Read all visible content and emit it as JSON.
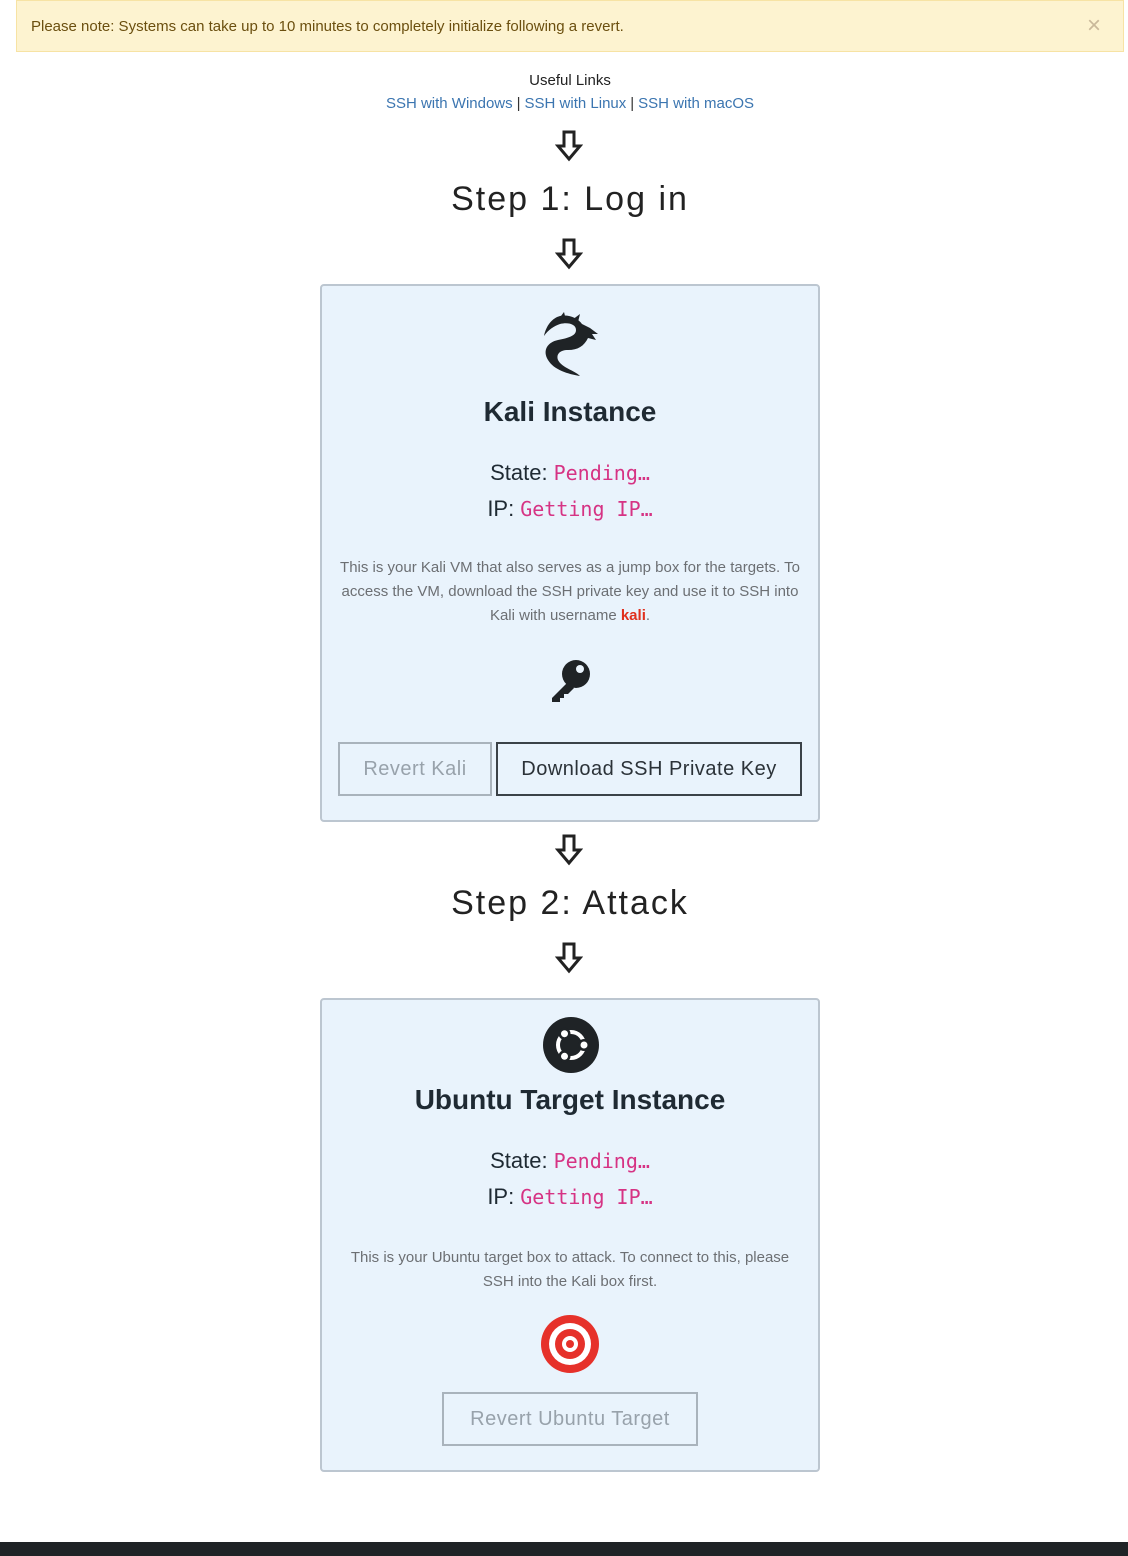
{
  "alert": {
    "message": "Please note: Systems can take up to 10 minutes to completely initialize following a revert.",
    "close_label": "×"
  },
  "useful_links": {
    "title": "Useful Links",
    "links": [
      {
        "label": "SSH with Windows"
      },
      {
        "label": "SSH with Linux"
      },
      {
        "label": "SSH with macOS"
      }
    ],
    "separator": "|"
  },
  "steps": [
    {
      "title": "Step 1: Log in"
    },
    {
      "title": "Step 2: Attack"
    }
  ],
  "kali": {
    "title": "Kali Instance",
    "state_label": "State:",
    "state_value": "Pending…",
    "ip_label": "IP:",
    "ip_value": "Getting IP…",
    "description_part1": "This is your Kali VM that also serves as a jump box for the targets. To access the VM, download the SSH private key and use it to SSH into Kali with username ",
    "username": "kali",
    "description_end": ".",
    "revert_button": "Revert Kali",
    "download_button": "Download SSH Private Key",
    "logo_icon": "kali-dragon-icon",
    "key_icon": "key-icon"
  },
  "ubuntu": {
    "title": "Ubuntu Target Instance",
    "state_label": "State:",
    "state_value": "Pending…",
    "ip_label": "IP:",
    "ip_value": "Getting IP…",
    "description": "This is your Ubuntu target box to attack. To connect to this, please SSH into the Kali box first.",
    "revert_button": "Revert Ubuntu Target",
    "logo_icon": "ubuntu-icon",
    "target_icon": "target-icon"
  },
  "colors": {
    "alert_bg": "#fdf3d0",
    "link": "#3b75b0",
    "card_bg": "#e9f3fc",
    "mono_value": "#d63384",
    "username_highlight": "#e0301e",
    "target_red": "#e6312a"
  }
}
